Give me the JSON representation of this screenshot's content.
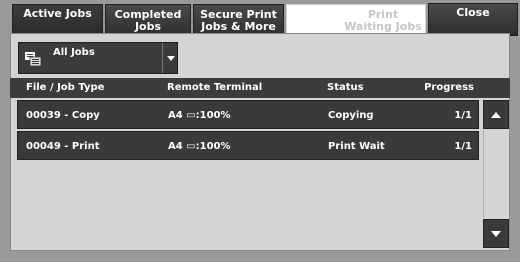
{
  "tabs": [
    {
      "label": "Active Jobs",
      "state": "active"
    },
    {
      "label1": "Completed",
      "label2": "Jobs"
    },
    {
      "label1": "Secure Print",
      "label2": "Jobs & More"
    },
    {
      "label": "",
      "state": "blank"
    },
    {
      "label1": "Print",
      "label2": "Waiting Jobs",
      "state": "disabled"
    },
    {
      "label": "Close"
    }
  ],
  "filter": {
    "selected": "All Jobs",
    "icon": "job-list-icon"
  },
  "columns": {
    "file_job_type": "File / Job Type",
    "remote_terminal": "Remote Terminal",
    "status": "Status",
    "progress": "Progress"
  },
  "jobs": [
    {
      "file": "00039 - Copy",
      "terminal": "A4 ▭:100%",
      "status": "Copying",
      "progress": "1/1"
    },
    {
      "file": "00049 - Print",
      "terminal": "A4 ▭:100%",
      "status": "Print Wait",
      "progress": "1/1"
    }
  ],
  "colors": {
    "tab_dark": "#3a3a3a",
    "panel": "#d4d4d4",
    "background": "#9a9a9a",
    "disabled_text": "#c6c6c6"
  }
}
